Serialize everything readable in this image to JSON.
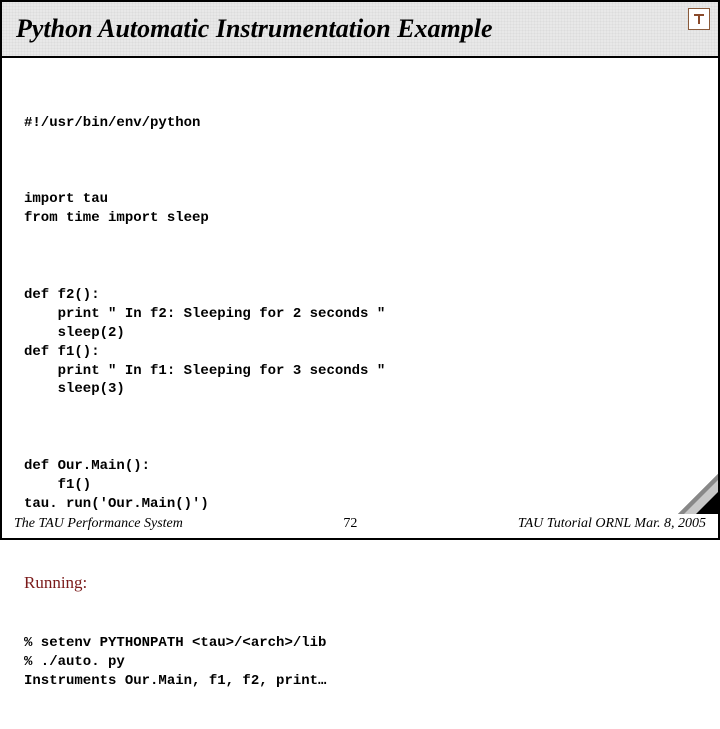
{
  "title": "Python Automatic Instrumentation Example",
  "code": {
    "shebang": "#!/usr/bin/env/python",
    "imports": "import tau\nfrom time import sleep",
    "defs": "def f2():\n    print \" In f2: Sleeping for 2 seconds \"\n    sleep(2)\ndef f1():\n    print \" In f1: Sleeping for 3 seconds \"\n    sleep(3)",
    "main": "def Our.Main():\n    f1()\ntau. run('Our.Main()')"
  },
  "running_label": "Running:",
  "running_cmds": "% setenv PYTHONPATH <tau>/<arch>/lib\n% ./auto. py\nInstruments Our.Main, f1, f2, print…",
  "footer": {
    "left": "The TAU Performance System",
    "page": "72",
    "right": "TAU Tutorial ORNL Mar. 8, 2005"
  }
}
